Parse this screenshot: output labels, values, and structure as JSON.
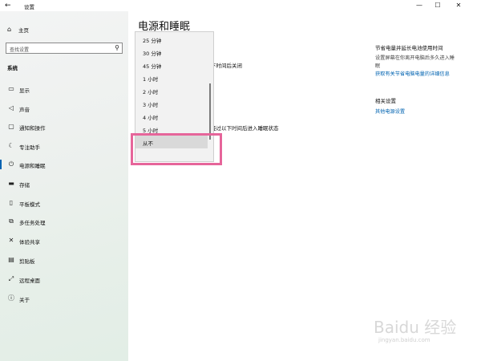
{
  "window": {
    "title": "设置",
    "controls": {
      "minimize": "—",
      "maximize": "☐",
      "close": "✕"
    }
  },
  "sidebar": {
    "home_label": "主页",
    "search_placeholder": "查找设置",
    "section_label": "系统",
    "items": [
      {
        "label": "显示",
        "icon": "monitor-icon"
      },
      {
        "label": "声音",
        "icon": "speaker-icon"
      },
      {
        "label": "通知和操作",
        "icon": "notification-icon"
      },
      {
        "label": "专注助手",
        "icon": "moon-icon"
      },
      {
        "label": "电源和睡眠",
        "icon": "power-icon",
        "active": true
      },
      {
        "label": "存储",
        "icon": "storage-icon"
      },
      {
        "label": "平板模式",
        "icon": "tablet-icon"
      },
      {
        "label": "多任务处理",
        "icon": "multitask-icon"
      },
      {
        "label": "体验共享",
        "icon": "share-icon"
      },
      {
        "label": "剪贴板",
        "icon": "clipboard-icon"
      },
      {
        "label": "远程桌面",
        "icon": "remote-desktop-icon"
      },
      {
        "label": "关于",
        "icon": "info-icon"
      }
    ]
  },
  "main": {
    "page_title": "电源和睡眠",
    "screen_text_partial": "下时间后关闭",
    "sleep_text_partial": "经过以下时间后进入睡眠状态"
  },
  "dropdown": {
    "options": [
      "25 分钟",
      "30 分钟",
      "45 分钟",
      "1 小时",
      "2 小时",
      "3 小时",
      "4 小时",
      "5 小时",
      "从不"
    ],
    "selected": "从不"
  },
  "right_panel": {
    "heading": "节省电量并延长电池使用时间",
    "desc_line1": "设置屏幕在你离开电脑后多久进入睡",
    "desc_line2": "眠",
    "link": "获取有关节省电脑电量的详细信息",
    "related_heading": "相关设置",
    "related_link": "其他电源设置"
  },
  "watermark": {
    "text": "Baidu 经验",
    "url": "jingyan.baidu.com"
  },
  "colors": {
    "accent": "#0063b1",
    "highlight": "#e6659a"
  }
}
